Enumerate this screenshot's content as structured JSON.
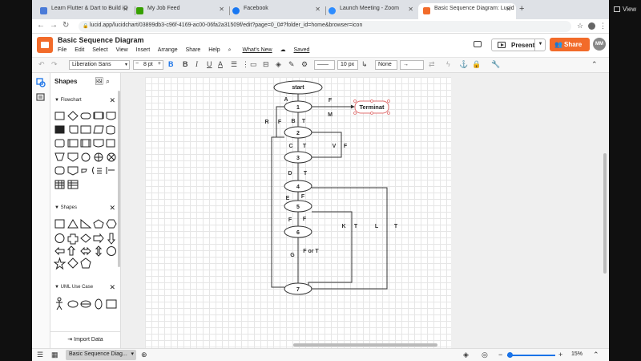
{
  "browser": {
    "tabs": [
      {
        "title": "Learn Flutter & Dart to Build iO",
        "color": "#4a7bd8"
      },
      {
        "title": "My Job Feed",
        "color": "#37a000"
      },
      {
        "title": "Facebook",
        "color": "#1877f2"
      },
      {
        "title": "Launch Meeting - Zoom",
        "color": "#2d8cff"
      },
      {
        "title": "Basic Sequence Diagram: Lucid",
        "color": "#f26b2a"
      }
    ],
    "new_tab": "+",
    "url": "lucid.app/lucidchart/03899db3-c96f-4169-ac00-06fa2a31509f/edit?page=0_0#?folder_id=home&browser=icon"
  },
  "app": {
    "title": "Basic Sequence Diagram",
    "menus": [
      "File",
      "Edit",
      "Select",
      "View",
      "Insert",
      "Arrange",
      "Share",
      "Help"
    ],
    "whats_new": "What's New",
    "saved": "Saved",
    "present_label": "Present",
    "share_label": "Share",
    "avatar_initials": "MM",
    "brand_color": "#f26b2a"
  },
  "toolbar": {
    "font": "Liberation Sans",
    "font_size": "8 pt",
    "line_width": "10 px",
    "line_start": "None"
  },
  "shapes_panel": {
    "title": "Shapes",
    "libraries": [
      {
        "name": "Flowchart"
      },
      {
        "name": "Shapes"
      },
      {
        "name": "UML Use Case"
      }
    ],
    "import_label": "Import Data"
  },
  "diagram": {
    "nodes": {
      "start": "start",
      "n1": "1",
      "n2": "2",
      "n3": "3",
      "n4": "4",
      "n5": "5",
      "n6": "6",
      "n7": "7",
      "terminat": "Terminat"
    },
    "labels": {
      "A": "A",
      "F1": "F",
      "M": "M",
      "R": "R",
      "F2": "F",
      "B": "B",
      "T1": "T",
      "C": "C",
      "T2": "T",
      "V": "V",
      "F3": "F",
      "D": "D",
      "T3": "T",
      "E": "E",
      "F4": "F",
      "F5": "F",
      "F6": "F",
      "K": "K",
      "T4": "T",
      "L": "L",
      "T5": "T",
      "G": "G",
      "ForT": "F or T"
    }
  },
  "status": {
    "page_tab": "Basic Sequence Diag...",
    "zoom": "15%"
  },
  "outer": {
    "view_label": "View"
  }
}
